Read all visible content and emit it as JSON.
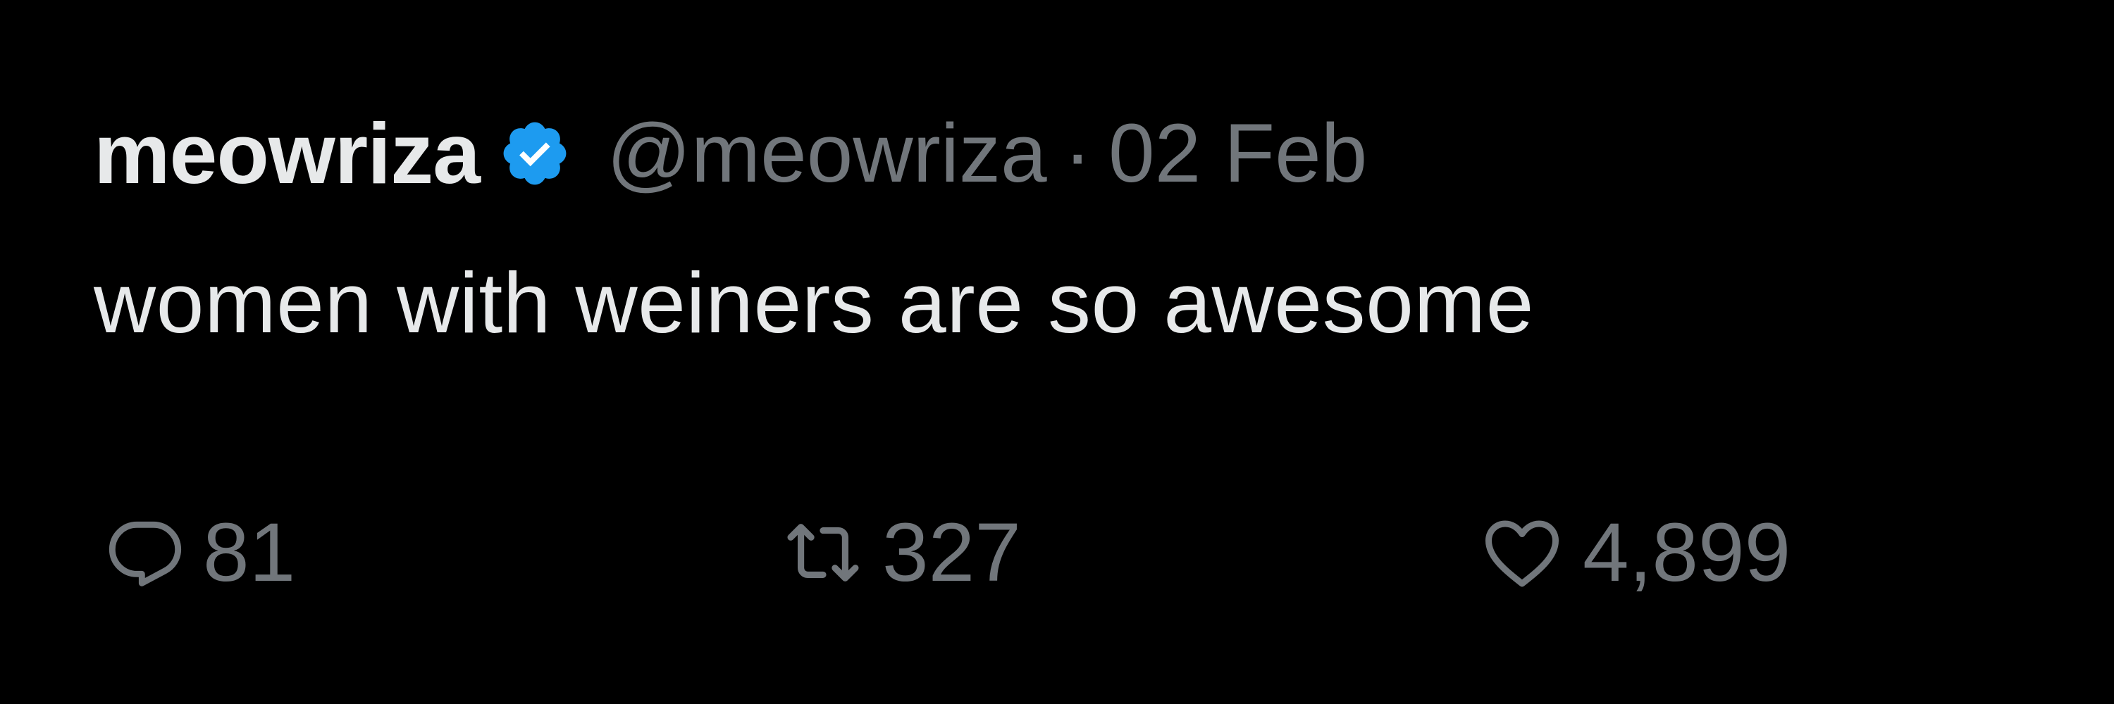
{
  "tweet": {
    "author": {
      "display_name": "meowriza",
      "handle": "@meowriza",
      "verified_badge_icon": "verified-badge-icon"
    },
    "separator": "·",
    "date": "02 Feb",
    "text": "women with weiners are so awesome",
    "actions": {
      "reply": {
        "icon": "reply-icon",
        "count": "81"
      },
      "retweet": {
        "icon": "retweet-icon",
        "count": "327"
      },
      "like": {
        "icon": "heart-icon",
        "count": "4,899"
      }
    }
  },
  "colors": {
    "background": "#000000",
    "primary_text": "#e7e9ea",
    "secondary_text": "#71767b",
    "verified_blue": "#1d9bf0"
  }
}
